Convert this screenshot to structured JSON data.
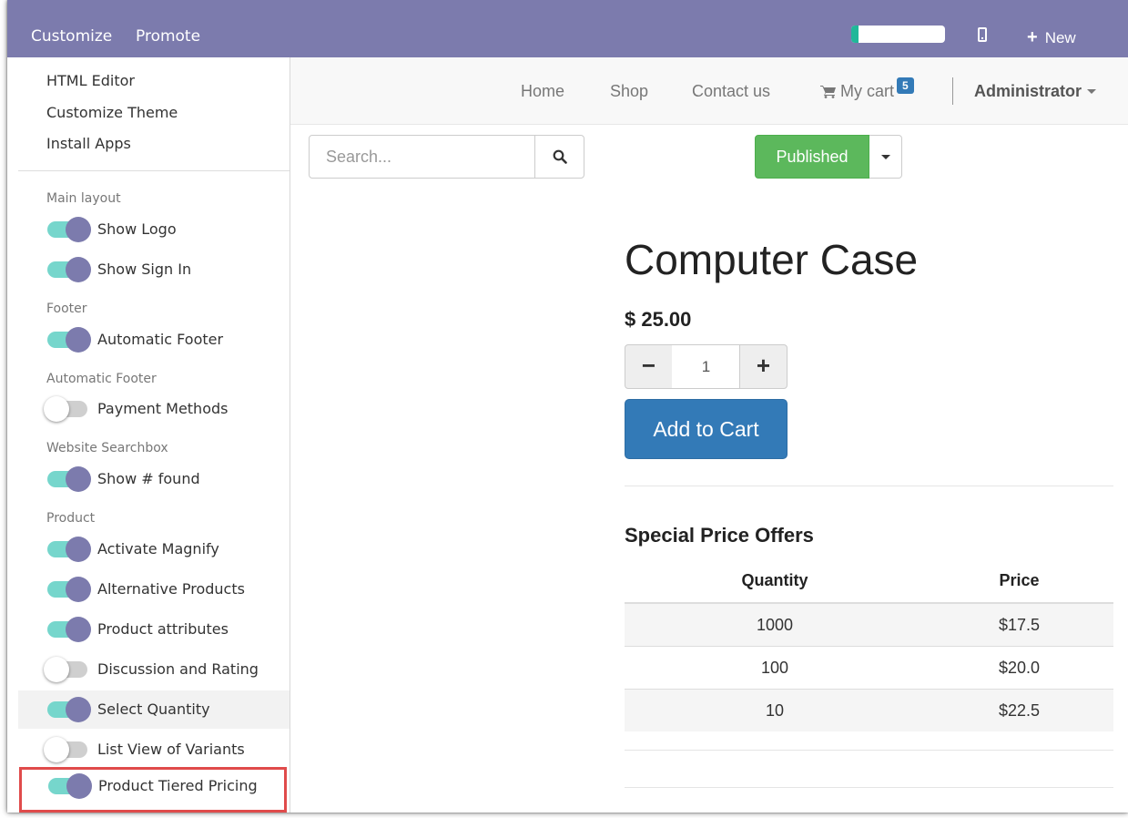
{
  "topbar": {
    "customize_label": "Customize",
    "promote_label": "Promote",
    "new_label": "New",
    "progress_fraction": 0.08,
    "progress_color": "#21b799",
    "bar_color": "#7c7bad",
    "mobile_icon": "mobile-icon",
    "plus_icon": "plus-icon"
  },
  "customize_menu": {
    "links": [
      "HTML Editor",
      "Customize Theme",
      "Install Apps"
    ],
    "sections": [
      {
        "header": "Main layout",
        "options": [
          {
            "label": "Show Logo",
            "on": true
          },
          {
            "label": "Show Sign In",
            "on": true
          }
        ]
      },
      {
        "header": "Footer",
        "options": [
          {
            "label": "Automatic Footer",
            "on": true
          }
        ]
      },
      {
        "header": "Automatic Footer",
        "options": [
          {
            "label": "Payment Methods",
            "on": false
          }
        ]
      },
      {
        "header": "Website Searchbox",
        "options": [
          {
            "label": "Show # found",
            "on": true
          }
        ]
      },
      {
        "header": "Product",
        "options": [
          {
            "label": "Activate Magnify",
            "on": true
          },
          {
            "label": "Alternative Products",
            "on": true
          },
          {
            "label": "Product attributes",
            "on": true
          },
          {
            "label": "Discussion and Rating",
            "on": false
          },
          {
            "label": "Select Quantity",
            "on": true
          },
          {
            "label": "List View of Variants",
            "on": false
          },
          {
            "label": "Product Tiered Pricing",
            "on": true
          }
        ]
      }
    ],
    "toggle_on_color": "#76d6cc",
    "knob_on_color": "#7c7bad",
    "highlight_color": "#e04b4b"
  },
  "navbar": {
    "home": "Home",
    "shop": "Shop",
    "contact": "Contact us",
    "cart_label": "My cart",
    "cart_count": "5",
    "user": "Administrator",
    "cart_icon": "shopping-cart-icon"
  },
  "search": {
    "placeholder": "Search...",
    "search_icon": "magnifier-icon"
  },
  "publish": {
    "label": "Published",
    "color": "#5cb85c"
  },
  "product": {
    "title": "Computer Case",
    "price": "$ 25.00",
    "quantity": "1",
    "minus": "−",
    "plus": "+",
    "add_to_cart": "Add to Cart",
    "button_color": "#337ab7"
  },
  "offers": {
    "title": "Special Price Offers",
    "headers": [
      "Quantity",
      "Price"
    ],
    "rows": [
      [
        "1000",
        "$17.5"
      ],
      [
        "100",
        "$20.0"
      ],
      [
        "10",
        "$22.5"
      ]
    ]
  }
}
